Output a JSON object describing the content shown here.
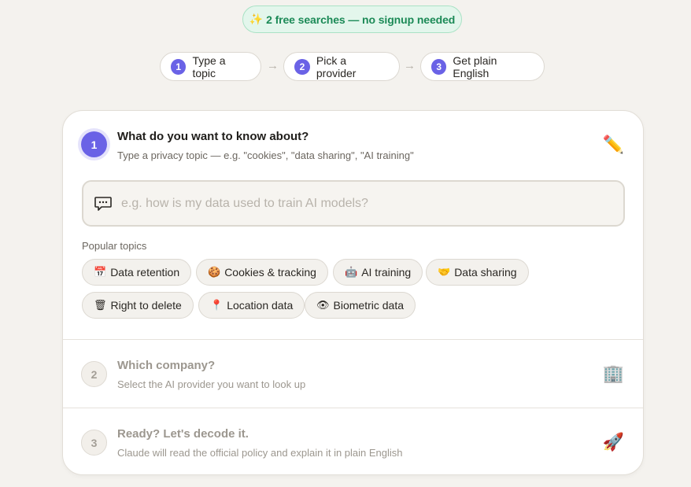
{
  "banner": {
    "icon": "sparkle-icon",
    "text": "2 free searches — no signup needed"
  },
  "stepper": [
    {
      "num": "1",
      "label": "Type a topic"
    },
    {
      "num": "2",
      "label": "Pick a provider"
    },
    {
      "num": "3",
      "label": "Get plain English"
    }
  ],
  "steps": {
    "one": {
      "num": "1",
      "title": "What do you want to know about?",
      "subtitle": "Type a privacy topic — e.g. \"cookies\", \"data sharing\", \"AI training\"",
      "icon": "pencil-icon"
    },
    "two": {
      "num": "2",
      "title": "Which company?",
      "subtitle": "Select the AI provider you want to look up",
      "icon": "office-building-icon"
    },
    "three": {
      "num": "3",
      "title": "Ready? Let's decode it.",
      "subtitle": "Claude will read the official policy and explain it in plain English",
      "icon": "rocket-icon"
    }
  },
  "search": {
    "placeholder": "e.g. how is my data used to train AI models?",
    "value": ""
  },
  "popular": {
    "label": "Popular topics",
    "chips": [
      {
        "icon": "calendar-icon",
        "glyph": "📅",
        "label": "Data retention"
      },
      {
        "icon": "cookie-icon",
        "glyph": "🍪",
        "label": "Cookies & tracking"
      },
      {
        "icon": "robot-icon",
        "glyph": "🤖",
        "label": "AI training"
      },
      {
        "icon": "handshake-icon",
        "glyph": "🤝",
        "label": "Data sharing"
      },
      {
        "icon": "trash-icon",
        "glyph": "🗑",
        "label": "Right to delete"
      },
      {
        "icon": "pin-icon",
        "glyph": "📍",
        "label": "Location data"
      },
      {
        "icon": "eye-icon",
        "glyph": "👁",
        "label": "Biometric data"
      }
    ]
  },
  "colors": {
    "accent": "#6a62e6",
    "banner_text": "#1c8a57",
    "banner_bg": "#e3f6ec"
  }
}
